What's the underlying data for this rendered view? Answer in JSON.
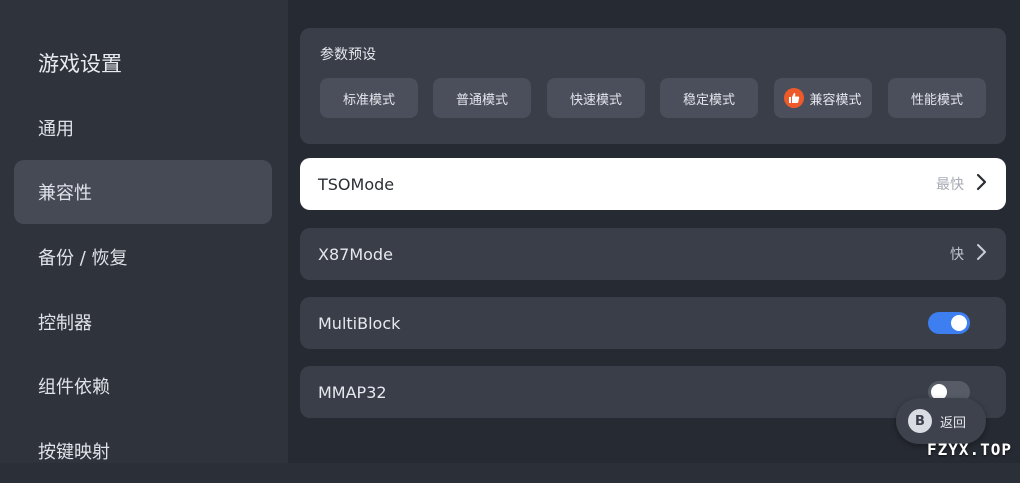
{
  "sidebar": {
    "title": "游戏设置",
    "items": [
      {
        "label": "通用",
        "active": false
      },
      {
        "label": "兼容性",
        "active": true
      },
      {
        "label": "备份 / 恢复",
        "active": false
      },
      {
        "label": "控制器",
        "active": false
      },
      {
        "label": "组件依赖",
        "active": false
      },
      {
        "label": "按键映射",
        "active": false
      }
    ]
  },
  "presets": {
    "title": "参数预设",
    "buttons": [
      {
        "label": "标准模式"
      },
      {
        "label": "普通模式"
      },
      {
        "label": "快速模式"
      },
      {
        "label": "稳定模式"
      },
      {
        "label": "兼容模式",
        "icon": "thumbs-up-icon",
        "selected": true
      },
      {
        "label": "性能模式"
      }
    ],
    "icon_color": "#ef5a2a"
  },
  "settings": [
    {
      "label": "TSOMode",
      "value": "最快",
      "type": "select",
      "selected": true
    },
    {
      "label": "X87Mode",
      "value": "快",
      "type": "select"
    },
    {
      "label": "MultiBlock",
      "type": "toggle",
      "on": true
    },
    {
      "label": "MMAP32",
      "type": "toggle",
      "on": false
    }
  ],
  "back_button": {
    "key": "B",
    "label": "返回"
  },
  "watermark": "FZYX.TOP",
  "colors": {
    "toggle_on": "#3d7ef0",
    "selected_row": "#ffffff"
  }
}
